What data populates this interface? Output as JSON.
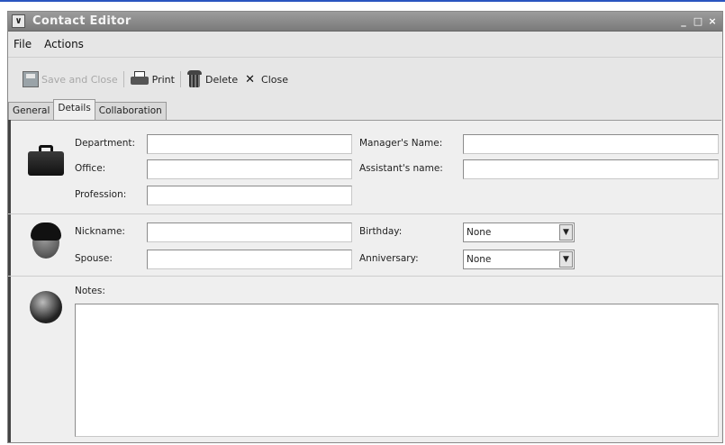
{
  "window": {
    "title": "Contact Editor",
    "controls": {
      "minimize": "_",
      "maximize": "□",
      "close": "×"
    }
  },
  "menubar": {
    "items": [
      {
        "label": "File"
      },
      {
        "label": "Actions"
      }
    ]
  },
  "toolbar": {
    "save_close_label": "Save and Close",
    "print_label": "Print",
    "delete_label": "Delete",
    "close_label": "Close"
  },
  "tabs": [
    {
      "label": "General",
      "active": false
    },
    {
      "label": "Details",
      "active": true
    },
    {
      "label": "Collaboration",
      "active": false
    }
  ],
  "details": {
    "work": {
      "department_label": "Department:",
      "office_label": "Office:",
      "profession_label": "Profession:",
      "manager_label": "Manager's Name:",
      "assistant_label": "Assistant's name:",
      "department_value": "",
      "office_value": "",
      "profession_value": "",
      "manager_value": "",
      "assistant_value": ""
    },
    "personal": {
      "nickname_label": "Nickname:",
      "spouse_label": "Spouse:",
      "birthday_label": "Birthday:",
      "anniversary_label": "Anniversary:",
      "nickname_value": "",
      "spouse_value": "",
      "birthday_value": "None",
      "anniversary_value": "None"
    },
    "notes": {
      "label": "Notes:",
      "value": ""
    }
  },
  "icons": {
    "work": "briefcase-icon",
    "personal": "person-face-icon",
    "notes": "globe-icon"
  },
  "colors": {
    "titlebar": "#8a8a8a",
    "accent_top": "#2a55c0"
  }
}
